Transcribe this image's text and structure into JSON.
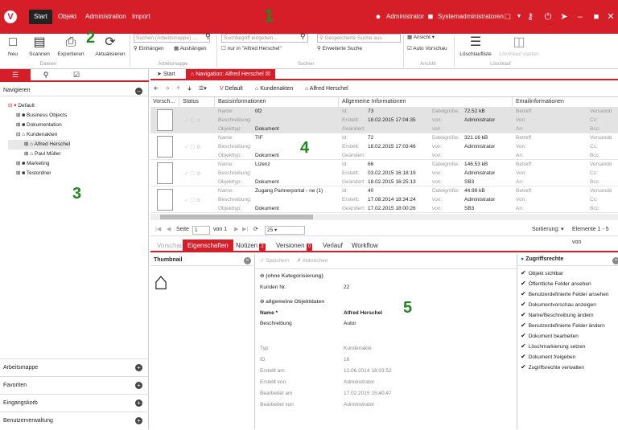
{
  "topbar": {
    "logo": "V",
    "menu": [
      "Start",
      "Objekt",
      "Administration",
      "Import"
    ],
    "user": "Administrator",
    "group": "Systemadministratoren",
    "icons": [
      "user-icon",
      "group-icon",
      "chat-icon",
      "key-icon",
      "power-icon",
      "send-icon",
      "minimize-icon",
      "maximize-icon",
      "close-icon"
    ]
  },
  "callouts": [
    "1",
    "2",
    "3",
    "4",
    "5"
  ],
  "ribbon": {
    "buttons": [
      "Neu",
      "Scannen",
      "Exportieren",
      "Aktualisieren"
    ],
    "group_dateien": "Dateien",
    "search_archiv_placeholder": "Suchen (Arbeitsmappe) ...",
    "einhaengen": "Einhängen",
    "aushaengen": "Aushängen",
    "group_arbeitsmappe": "Arbeitsmappe",
    "search_term_placeholder": "Suchbegriff eingeben...",
    "nur_in": "nur in \"Alfred Herschel\"",
    "saved_search_placeholder": "Gespeicherte Suche aus",
    "erweiterte_suche": "Erweiterte Suche",
    "group_suchen": "Suchen",
    "ansicht": "Ansicht",
    "auto_vorschau": "Auto Vorschau",
    "group_ansicht": "Ansicht",
    "loeschliste": "Löschlaufliste",
    "loeschlauf_starten": "Löschlauf starten",
    "group_loeschlauf": "Löschlauf"
  },
  "left": {
    "section": "Navigieren",
    "tree": [
      {
        "label": "Default",
        "level": 0
      },
      {
        "label": "Business Objects",
        "level": 1
      },
      {
        "label": "Dokumentation",
        "level": 1
      },
      {
        "label": "Kundenakten",
        "level": 1
      },
      {
        "label": "Alfred Herschel",
        "level": 2
      },
      {
        "label": "Paul Müller",
        "level": 2
      },
      {
        "label": "Marketing",
        "level": 1
      },
      {
        "label": "Testordner",
        "level": 1
      }
    ],
    "bottom": [
      "Arbeitsmappe",
      "Favoriten",
      "Eingangskorb",
      "Benutzerverwaltung"
    ]
  },
  "tabs": [
    "Start",
    "Navigation: Alfred Herschel"
  ],
  "breadcrumb": [
    "Default",
    "Kundenakten",
    "Alfred Herschel"
  ],
  "grid": {
    "headers": [
      "Vorsch...",
      "Status",
      "Basisinformationen",
      "Allgemeine Informationen",
      "Emailinformationen"
    ],
    "labels": {
      "name": "Name:",
      "beschreibung": "Beschreibung:",
      "objekttyp": "Objekttyp:",
      "id": "Id:",
      "erstellt": "Erstellt:",
      "geaendert": "Geändert:",
      "dateigroesse": "Dateigröße:",
      "von": "von:",
      "betreff": "Betreff:",
      "von2": "Von:",
      "an": "An:",
      "versand": "Versandd",
      "cc": "Cc:",
      "bcc": "Bcc:"
    },
    "rows": [
      {
        "name": "tif2",
        "typ": "Dokument",
        "id": "73",
        "erstellt": "18.02.2015 17:04:35",
        "geaendert": "",
        "groesse": "72.52 kB",
        "von_e": "Administrator",
        "von_g": ""
      },
      {
        "name": "TIF",
        "typ": "Dokument",
        "id": "72",
        "erstellt": "18.02.2015 17:03:46",
        "geaendert": "",
        "groesse": "321.16 kB",
        "von_e": "Administrator",
        "von_g": ""
      },
      {
        "name": "Lizenz",
        "typ": "Dokument",
        "id": "66",
        "erstellt": "03.02.2015 16:18:19",
        "geaendert": "18.02.2015 16:25:13",
        "groesse": "146.53 kB",
        "von_e": "Administrator",
        "von_g": "SB3"
      },
      {
        "name": "Zugang Partnerportal - ne (1)",
        "typ": "Dokument",
        "id": "40",
        "erstellt": "17.08.2014 18:34:24",
        "geaendert": "17.02.2015 18:00:26",
        "groesse": "44.99 kB",
        "von_e": "Administrator",
        "von_g": "SB3"
      }
    ]
  },
  "pager": {
    "seite": "Seite",
    "page": "1",
    "von": "von 1",
    "per_page": "25",
    "sortierung": "Sortierung:",
    "elemente": "Elemente 1 - 5 von"
  },
  "detail_tabs": [
    {
      "label": "Vorschau",
      "badge": ""
    },
    {
      "label": "Eigenschaften",
      "badge": ""
    },
    {
      "label": "Notizen",
      "badge": "2"
    },
    {
      "label": "Versionen",
      "badge": "0"
    },
    {
      "label": "Verlauf",
      "badge": ""
    },
    {
      "label": "Workflow",
      "badge": ""
    }
  ],
  "thumbnail": {
    "title": "Thumbnail"
  },
  "properties": {
    "speichern": "Speichern",
    "abbrechen": "Abbrechen",
    "section1": "(ohne Kategorisierung)",
    "kunden_nr_label": "Kunden Nr.",
    "kunden_nr": "22",
    "section2": "allgemeine Objektdaten",
    "name_label": "Name *",
    "name_value": "Alfred Herschel",
    "beschr_label": "Beschreibung",
    "beschr_value": "Autor",
    "meta": [
      {
        "k": "Typ",
        "v": "Kundenakte"
      },
      {
        "k": "ID",
        "v": "16"
      },
      {
        "k": "Erstellt am",
        "v": "12.06.2014 18:03:52"
      },
      {
        "k": "Erstellt von",
        "v": "Administrator"
      },
      {
        "k": "Bearbeitet am",
        "v": "17.02.2015 15:40:47"
      },
      {
        "k": "Bearbeitet von",
        "v": "Administrator"
      }
    ]
  },
  "rights": {
    "title": "Zugriffsrechte",
    "items": [
      "Objekt sichtbar",
      "Öffentliche Felder ansehen",
      "Benutzerdefinierte Felder ansehen",
      "Dokumentvorschau anzeigen",
      "Name/Beschreibung ändern",
      "Benutzerdefinierte Felder ändern",
      "Dokument bearbeiten",
      "Löschmarkierung setzen",
      "Dokument freigeben",
      "Zugriffsrechte verwalten"
    ]
  },
  "colors": {
    "accent": "#d51e27",
    "callout": "#1e8a1e"
  }
}
